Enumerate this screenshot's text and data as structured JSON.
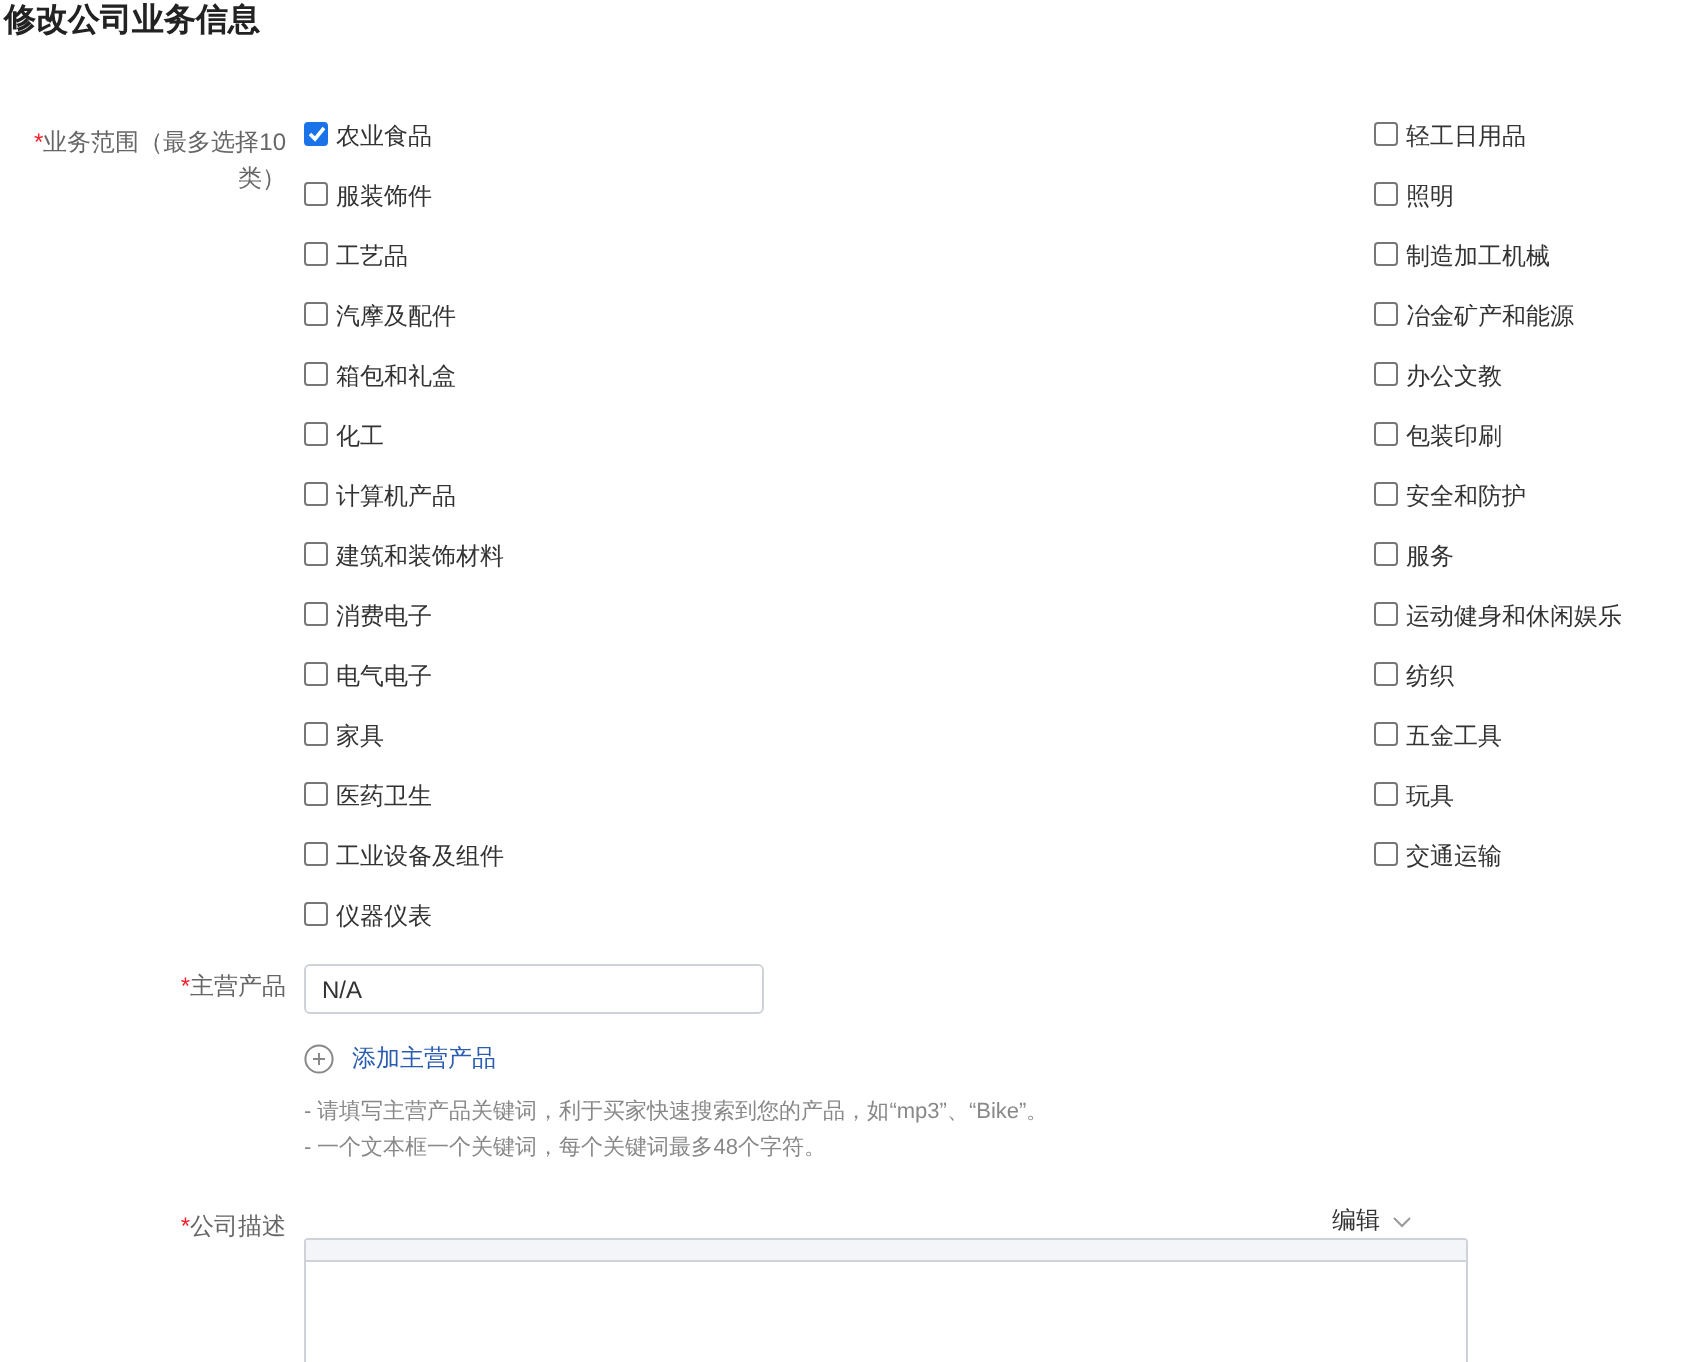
{
  "title": "修改公司业务信息",
  "business_scope": {
    "required_mark": "*",
    "label": "业务范围（最多选择10类）",
    "options": [
      {
        "label": "农业食品",
        "checked": true
      },
      {
        "label": "服装饰件",
        "checked": false
      },
      {
        "label": "工艺品",
        "checked": false
      },
      {
        "label": "汽摩及配件",
        "checked": false
      },
      {
        "label": "箱包和礼盒",
        "checked": false
      },
      {
        "label": "化工",
        "checked": false
      },
      {
        "label": "计算机产品",
        "checked": false
      },
      {
        "label": "建筑和装饰材料",
        "checked": false
      },
      {
        "label": "消费电子",
        "checked": false
      },
      {
        "label": "电气电子",
        "checked": false
      },
      {
        "label": "家具",
        "checked": false
      },
      {
        "label": "医药卫生",
        "checked": false
      },
      {
        "label": "工业设备及组件",
        "checked": false
      },
      {
        "label": "仪器仪表",
        "checked": false
      },
      {
        "label": "轻工日用品",
        "checked": false
      },
      {
        "label": "照明",
        "checked": false
      },
      {
        "label": "制造加工机械",
        "checked": false
      },
      {
        "label": "冶金矿产和能源",
        "checked": false
      },
      {
        "label": "办公文教",
        "checked": false
      },
      {
        "label": "包装印刷",
        "checked": false
      },
      {
        "label": "安全和防护",
        "checked": false
      },
      {
        "label": "服务",
        "checked": false
      },
      {
        "label": "运动健身和休闲娱乐",
        "checked": false
      },
      {
        "label": "纺织",
        "checked": false
      },
      {
        "label": "五金工具",
        "checked": false
      },
      {
        "label": "玩具",
        "checked": false
      },
      {
        "label": "交通运输",
        "checked": false
      }
    ]
  },
  "main_products": {
    "required_mark": "*",
    "label": "主营产品",
    "value": "N/A",
    "add_link": "添加主营产品",
    "hints": [
      "- 请填写主营产品关键词，利于买家快速搜索到您的产品，如“mp3”、“Bike”。",
      "- 一个文本框一个关键词，每个关键词最多48个字符。"
    ]
  },
  "description": {
    "required_mark": "*",
    "label": "公司描述",
    "edit_menu": "编辑"
  }
}
